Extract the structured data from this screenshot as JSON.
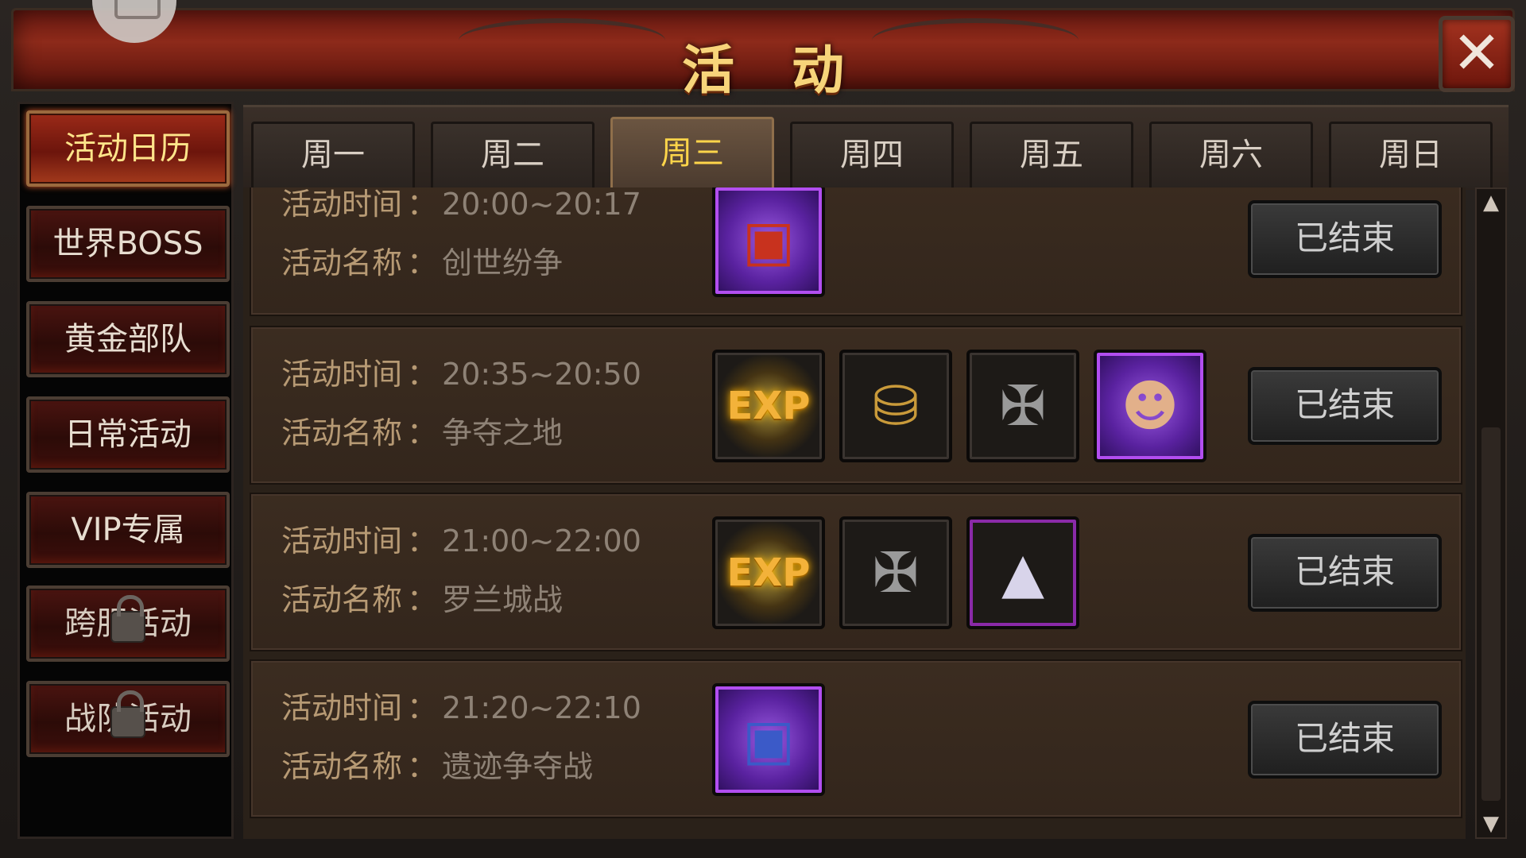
{
  "header": {
    "title": "活动",
    "close_icon": "close-x-icon"
  },
  "sidebar": {
    "items": [
      {
        "label": "活动日历",
        "active": true,
        "locked": false
      },
      {
        "label": "世界BOSS",
        "active": false,
        "locked": false
      },
      {
        "label": "黄金部队",
        "active": false,
        "locked": false
      },
      {
        "label": "日常活动",
        "active": false,
        "locked": false
      },
      {
        "label": "VIP专属",
        "active": false,
        "locked": false
      },
      {
        "label": "跨服活动",
        "active": false,
        "locked": true
      },
      {
        "label": "战队活动",
        "active": false,
        "locked": true
      }
    ]
  },
  "tabs": [
    {
      "label": "周一",
      "active": false
    },
    {
      "label": "周二",
      "active": false
    },
    {
      "label": "周三",
      "active": true
    },
    {
      "label": "周四",
      "active": false
    },
    {
      "label": "周五",
      "active": false
    },
    {
      "label": "周六",
      "active": false
    },
    {
      "label": "周日",
      "active": false
    }
  ],
  "labels": {
    "time_label": "活动时间",
    "name_label": "活动名称",
    "colon": "："
  },
  "activities": [
    {
      "time": "20:00~20:17",
      "name": "创世纷争",
      "status": "已结束",
      "rewards": [
        "red-treasure-chest-icon"
      ]
    },
    {
      "time": "20:35~20:50",
      "name": "争夺之地",
      "status": "已结束",
      "rewards": [
        "exp-icon",
        "gold-coins-icon",
        "demon-emblem-icon",
        "hero-portrait-icon"
      ]
    },
    {
      "time": "21:00~22:00",
      "name": "罗兰城战",
      "status": "已结束",
      "rewards": [
        "exp-icon",
        "demon-emblem-icon",
        "silver-powder-icon"
      ]
    },
    {
      "time": "21:20~22:10",
      "name": "遗迹争夺战",
      "status": "已结束",
      "rewards": [
        "blue-treasure-chest-icon"
      ]
    }
  ],
  "reward_text": {
    "exp": "EXP"
  },
  "colors": {
    "active_tab_text": "#ffd54a",
    "title_text": "#f7d47a",
    "label_text": "#b79a74",
    "value_text": "#8e8276"
  }
}
